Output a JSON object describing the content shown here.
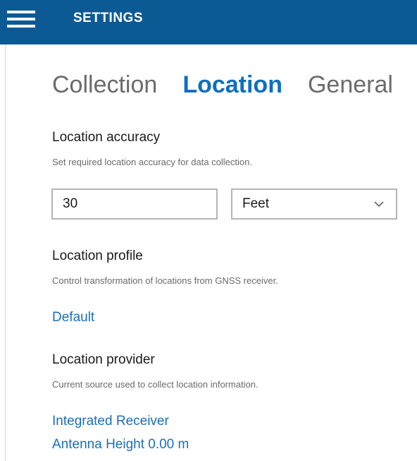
{
  "header": {
    "title": "SETTINGS",
    "menu_icon": "hamburger-menu-icon"
  },
  "tabs": [
    {
      "label": "Collection",
      "active": false
    },
    {
      "label": "Location",
      "active": true
    },
    {
      "label": "General",
      "active": false
    }
  ],
  "accuracy": {
    "title": "Location accuracy",
    "description": "Set required location accuracy for data collection.",
    "value": "30",
    "unit": "Feet"
  },
  "profile": {
    "title": "Location profile",
    "description": "Control transformation of locations from GNSS receiver.",
    "link": "Default"
  },
  "provider": {
    "title": "Location provider",
    "description": "Current source used to collect location information.",
    "link": "Integrated Receiver",
    "antenna": "Antenna Height 0.00 m"
  },
  "colors": {
    "header": "#0b5a94",
    "accent": "#0e6fbf",
    "link": "#1a6fb8"
  }
}
